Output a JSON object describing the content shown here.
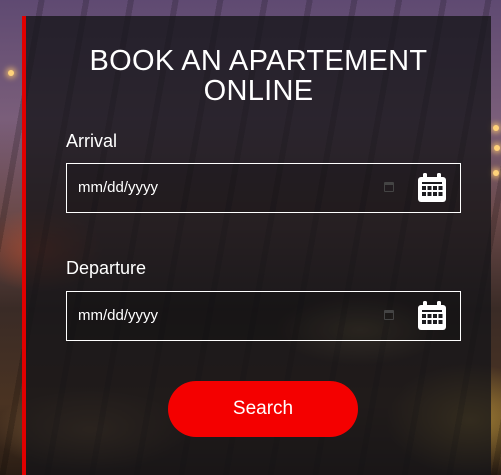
{
  "form": {
    "title_line1": "BOOK AN APARTEMENT",
    "title_line2": "ONLINE",
    "arrival": {
      "label": "Arrival",
      "value": "mm/dd/yyyy"
    },
    "departure": {
      "label": "Departure",
      "value": "mm/dd/yyyy"
    },
    "search_label": "Search"
  },
  "colors": {
    "accent": "#f40000",
    "panel": "#141418",
    "border": "#e00000"
  },
  "icons": [
    "calendar-icon",
    "calendar-picker-icon"
  ]
}
